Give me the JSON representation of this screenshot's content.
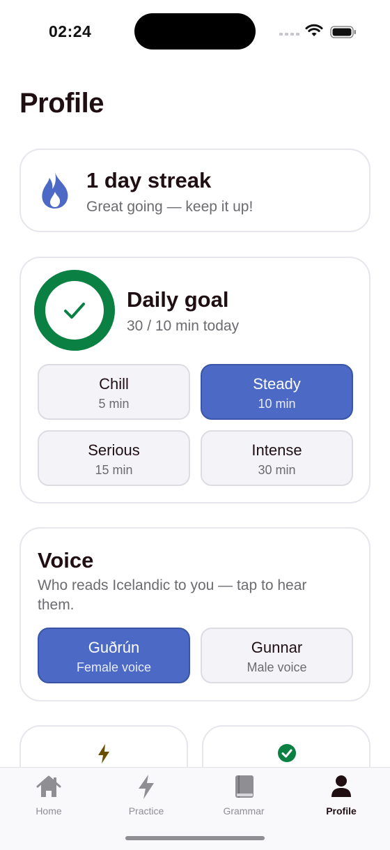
{
  "status_bar": {
    "time": "02:24"
  },
  "page": {
    "title": "Profile"
  },
  "streak": {
    "title": "1 day streak",
    "subtitle": "Great going — keep it up!"
  },
  "daily_goal": {
    "title": "Daily goal",
    "progress_text": "30 / 10 min today",
    "progress_fraction": 1.0,
    "options": [
      {
        "label": "Chill",
        "minutes": "5 min",
        "selected": false
      },
      {
        "label": "Steady",
        "minutes": "10 min",
        "selected": true
      },
      {
        "label": "Serious",
        "minutes": "15 min",
        "selected": false
      },
      {
        "label": "Intense",
        "minutes": "30 min",
        "selected": false
      }
    ]
  },
  "voice": {
    "title": "Voice",
    "description": "Who reads Icelandic to you — tap to hear them.",
    "options": [
      {
        "name": "Guðrún",
        "type": "Female voice",
        "selected": true
      },
      {
        "name": "Gunnar",
        "type": "Male voice",
        "selected": false
      }
    ]
  },
  "stat_cards": [
    {
      "icon": "lightning-bolt-icon"
    },
    {
      "icon": "check-circle-icon"
    }
  ],
  "tab_bar": {
    "tabs": [
      {
        "label": "Home",
        "icon": "house-icon",
        "active": false
      },
      {
        "label": "Practice",
        "icon": "lightning-bolt-icon",
        "active": false
      },
      {
        "label": "Grammar",
        "icon": "book-icon",
        "active": false
      },
      {
        "label": "Profile",
        "icon": "person-icon",
        "active": true
      }
    ]
  },
  "colors": {
    "accent": "#4c6ac5",
    "goal_green": "#0a8043",
    "bolt": "#6b4f00",
    "text": "#1f0f12",
    "muted": "#6b6b70"
  }
}
